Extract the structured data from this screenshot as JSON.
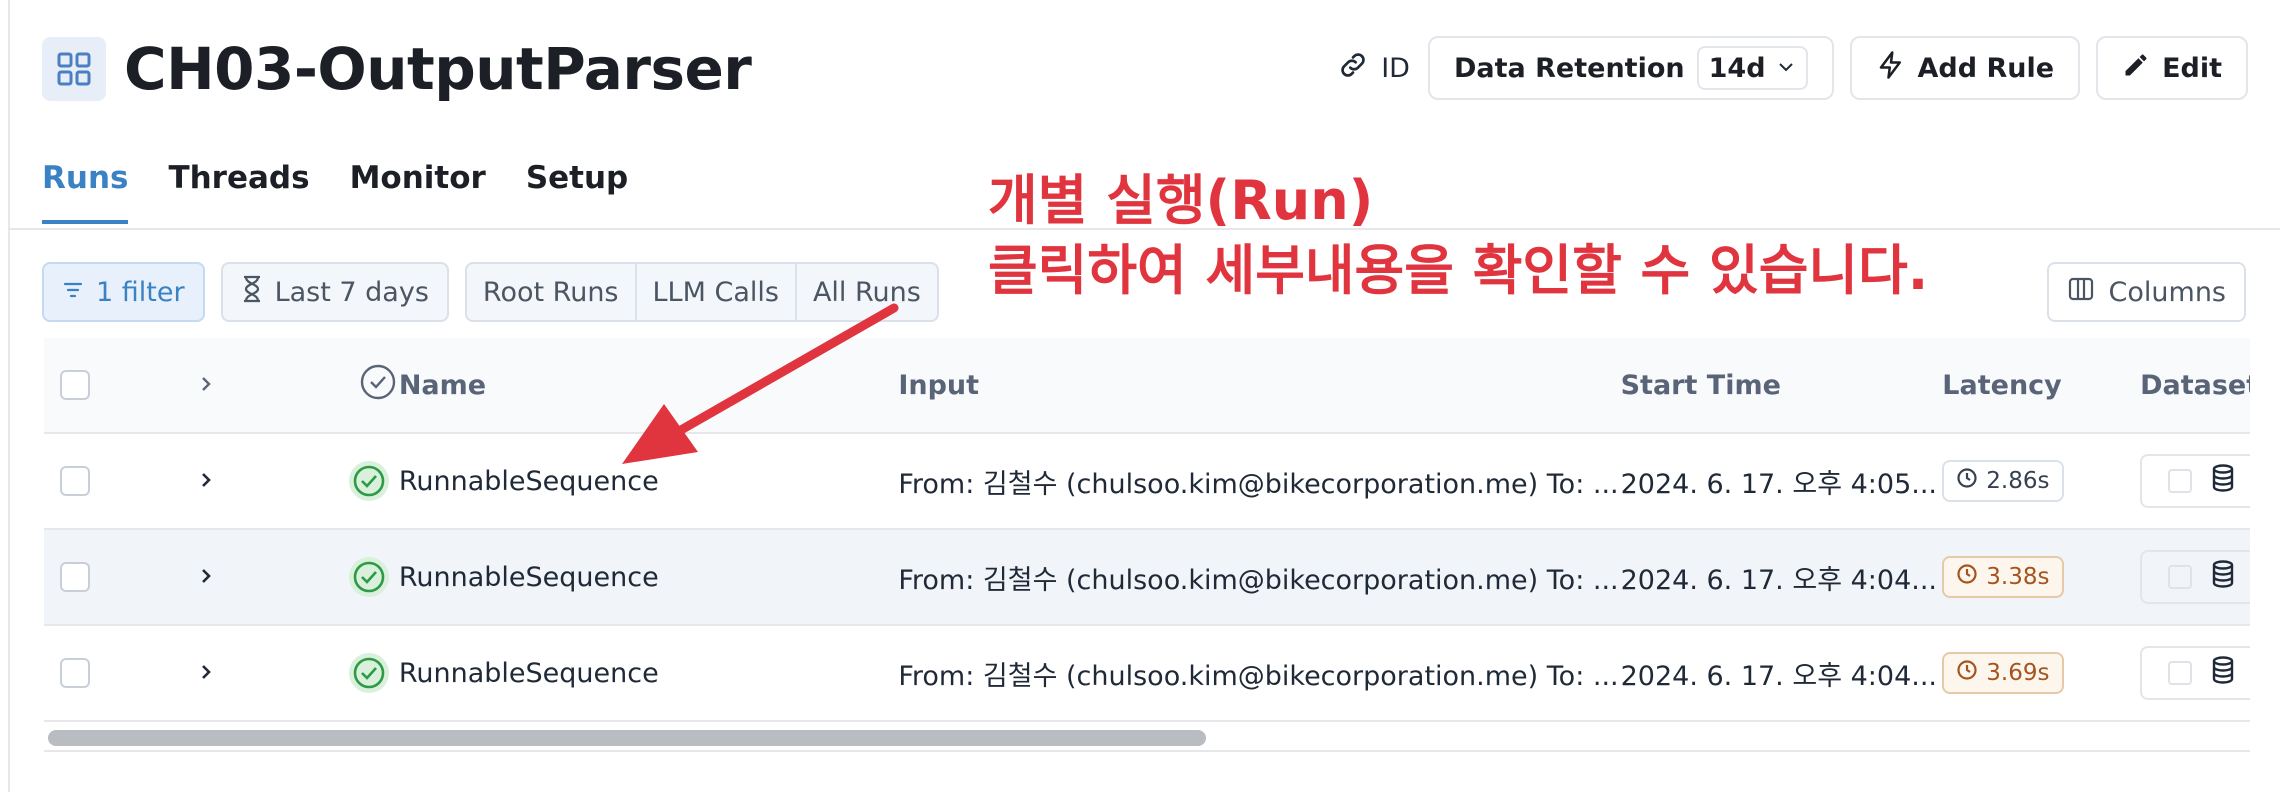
{
  "header": {
    "title": "CH03-OutputParser",
    "project_icon": "grid-icon",
    "id_label": "ID",
    "data_retention_label": "Data Retention",
    "data_retention_value": "14d",
    "add_rule_label": "Add Rule",
    "edit_label": "Edit"
  },
  "tabs": [
    {
      "label": "Runs",
      "active": true
    },
    {
      "label": "Threads",
      "active": false
    },
    {
      "label": "Monitor",
      "active": false
    },
    {
      "label": "Setup",
      "active": false
    }
  ],
  "toolbar": {
    "filter_label": "1 filter",
    "time_range_label": "Last 7 days",
    "run_types": [
      "Root Runs",
      "LLM Calls",
      "All Runs"
    ],
    "columns_label": "Columns"
  },
  "table": {
    "columns": [
      "Name",
      "Input",
      "Start Time",
      "Latency",
      "Dataset"
    ],
    "rows": [
      {
        "name": "RunnableSequence",
        "input": "From: 김철수 (chulsoo.kim@bikecorporation.me) To: ...",
        "start_time": "2024. 6. 17. 오후 4:05...",
        "latency": "2.86s",
        "latency_status": "normal"
      },
      {
        "name": "RunnableSequence",
        "input": "From: 김철수 (chulsoo.kim@bikecorporation.me) To: ...",
        "start_time": "2024. 6. 17. 오후 4:04...",
        "latency": "3.38s",
        "latency_status": "warn"
      },
      {
        "name": "RunnableSequence",
        "input": "From: 김철수 (chulsoo.kim@bikecorporation.me) To: ...",
        "start_time": "2024. 6. 17. 오후 4:04...",
        "latency": "3.69s",
        "latency_status": "warn"
      }
    ]
  },
  "annotation": {
    "line1": "개별 실행(Run)",
    "line2": "클릭하여 세부내용을 확인할 수 있습니다.",
    "color": "#e0353f"
  },
  "colors": {
    "accent": "#3b82c4",
    "success": "#2e9a44",
    "warn": "#a4541e"
  }
}
